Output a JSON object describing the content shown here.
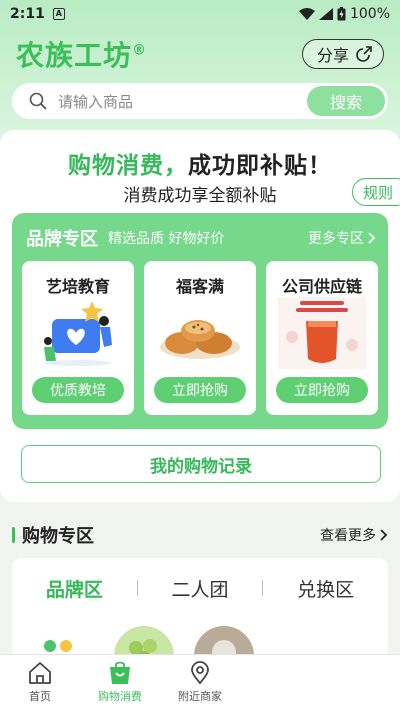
{
  "status_bar": {
    "time": "2:11",
    "notification_icon": "A",
    "battery": "100%"
  },
  "header": {
    "app_title": "农族工坊",
    "registered_mark": "®",
    "share_label": "分享"
  },
  "search": {
    "placeholder": "请输入商品",
    "button_label": "搜索"
  },
  "promo": {
    "title_green": "购物消费，",
    "title_dark": "成功即补贴！",
    "subtitle": "消费成功享全额补贴",
    "rules_label": "规则"
  },
  "brand_zone": {
    "title": "品牌专区",
    "tagline": "精选品质  好物好价",
    "more_label": "更多专区",
    "cards": [
      {
        "name": "艺培教育",
        "cta": "优质教培"
      },
      {
        "name": "福客满",
        "cta": "立即抢购"
      },
      {
        "name": "公司供应链",
        "cta": "立即抢购"
      }
    ]
  },
  "records_button": "我的购物记录",
  "shopping_section": {
    "title": "购物专区",
    "more_label": "查看更多",
    "tabs": [
      "品牌区",
      "二人团",
      "兑换区"
    ],
    "active_tab": 0
  },
  "bottom_nav": [
    {
      "label": "首页",
      "icon": "home-icon"
    },
    {
      "label": "购物消费",
      "icon": "shopping-bag-icon"
    },
    {
      "label": "附近商家",
      "icon": "location-pin-icon"
    }
  ],
  "colors": {
    "accent": "#3bbf59",
    "brand_zone_bg": "#76d88a",
    "cta_bg": "#5fcf74"
  }
}
